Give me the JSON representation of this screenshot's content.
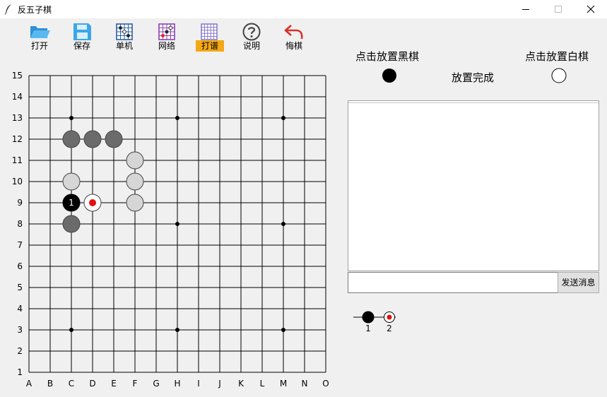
{
  "window": {
    "title": "反五子棋",
    "controls": {
      "minimize": "—",
      "maximize": "☐",
      "close": "✕"
    }
  },
  "toolbar": [
    {
      "name": "open",
      "label": "打开",
      "icon": "folder-open-icon"
    },
    {
      "name": "save",
      "label": "保存",
      "icon": "floppy-disk-icon"
    },
    {
      "name": "single",
      "label": "单机",
      "icon": "board-grid-icon"
    },
    {
      "name": "network",
      "label": "网络",
      "icon": "network-board-icon"
    },
    {
      "name": "record",
      "label": "打谱",
      "icon": "record-grid-icon",
      "active": true
    },
    {
      "name": "help",
      "label": "说明",
      "icon": "help-icon"
    },
    {
      "name": "undo",
      "label": "悔棋",
      "icon": "undo-arrow-icon"
    }
  ],
  "board": {
    "row_labels": [
      "15",
      "14",
      "13",
      "12",
      "11",
      "10",
      "9",
      "8",
      "7",
      "6",
      "5",
      "4",
      "3",
      "2",
      "1"
    ],
    "col_labels": [
      "A",
      "B",
      "C",
      "D",
      "E",
      "F",
      "G",
      "H",
      "I",
      "J",
      "K",
      "L",
      "M",
      "N",
      "O"
    ],
    "star_points": [
      "C13",
      "H13",
      "M13",
      "H8",
      "M8",
      "C3",
      "H3",
      "M3"
    ],
    "stones": [
      {
        "pos": "C12",
        "color": "dark-gray"
      },
      {
        "pos": "D12",
        "color": "dark-gray"
      },
      {
        "pos": "E12",
        "color": "dark-gray"
      },
      {
        "pos": "C8",
        "color": "dark-gray"
      },
      {
        "pos": "F11",
        "color": "light-gray"
      },
      {
        "pos": "C10",
        "color": "light-gray"
      },
      {
        "pos": "F10",
        "color": "light-gray"
      },
      {
        "pos": "F9",
        "color": "light-gray"
      },
      {
        "pos": "C9",
        "color": "black",
        "number": "1"
      },
      {
        "pos": "D9",
        "color": "white",
        "last_move": true
      }
    ],
    "colors": {
      "line": "#000000",
      "black": "#000000",
      "dark-gray": "#6b6b6b",
      "light-gray": "#d6d6d6",
      "white": "#ffffff",
      "last_marker": "#e01010"
    }
  },
  "panel": {
    "place_black_label": "点击放置黑棋",
    "place_white_label": "点击放置白棋",
    "done_label": "放置完成",
    "send_label": "发送消息",
    "message_value": "",
    "history": [
      {
        "number": "1",
        "color": "black"
      },
      {
        "number": "2",
        "color": "white",
        "last_move": true
      }
    ]
  }
}
